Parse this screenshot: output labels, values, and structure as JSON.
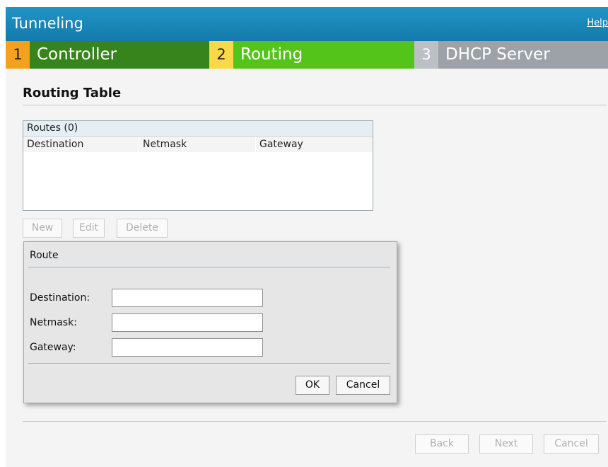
{
  "header": {
    "title": "Tunneling",
    "help_label": "Help"
  },
  "wizard_steps": [
    {
      "number": "1",
      "label": "Controller"
    },
    {
      "number": "2",
      "label": "Routing"
    },
    {
      "number": "3",
      "label": "DHCP Server"
    }
  ],
  "section": {
    "title": "Routing Table"
  },
  "routes_table": {
    "caption": "Routes (0)",
    "columns": [
      "Destination",
      "Netmask",
      "Gateway"
    ],
    "rows": []
  },
  "table_actions": {
    "new": "New",
    "edit": "Edit",
    "delete": "Delete"
  },
  "route_dialog": {
    "title": "Route",
    "fields": [
      {
        "label": "Destination:",
        "value": ""
      },
      {
        "label": "Netmask:",
        "value": ""
      },
      {
        "label": "Gateway:",
        "value": ""
      }
    ],
    "ok": "OK",
    "cancel": "Cancel"
  },
  "footer": {
    "back": "Back",
    "next": "Next",
    "cancel": "Cancel"
  },
  "colors": {
    "header_blue": "#137aab",
    "step1_number": "#f5a11f",
    "step1_bar": "#38841c",
    "step2_number": "#f9d84a",
    "step2_bar": "#55c41a",
    "step3_bar": "#9da2a8"
  }
}
